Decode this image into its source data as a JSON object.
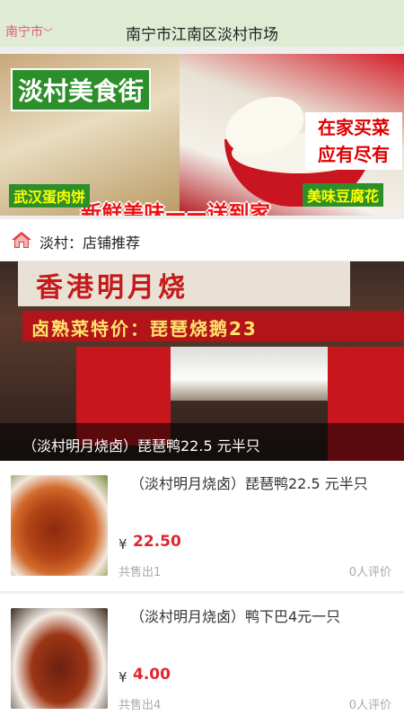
{
  "header": {
    "city": "南宁市",
    "title": "南宁市江南区淡村市场"
  },
  "banner": {
    "left_title": "淡村美食街",
    "slogan": "新鲜美味——送到家",
    "left_caption": "武汉蛋肉饼",
    "right_title": "在家买菜 应有尽有",
    "right_caption": "美味豆腐花"
  },
  "section": {
    "label": "淡村：店铺推荐",
    "icon": "home-icon"
  },
  "hero": {
    "sign_text": "香港明月烧",
    "board_text": "卤熟菜特价：琵琶烧鹅23",
    "caption": "（淡村明月烧卤）琵琶鸭22.5 元半只"
  },
  "products": [
    {
      "name": "（淡村明月烧卤）琵琶鸭22.5 元半只",
      "currency": "¥",
      "price": "22.50",
      "sold": "共售出1",
      "reviews": "0人评价"
    },
    {
      "name": "（淡村明月烧卤）鸭下巴4元一只",
      "currency": "¥",
      "price": "4.00",
      "sold": "共售出4",
      "reviews": "0人评价"
    }
  ],
  "colors": {
    "header_bg": "#dfecd3",
    "city_text": "#e05a7a",
    "price": "#e0262d",
    "banner_green": "#2c8f2a"
  }
}
